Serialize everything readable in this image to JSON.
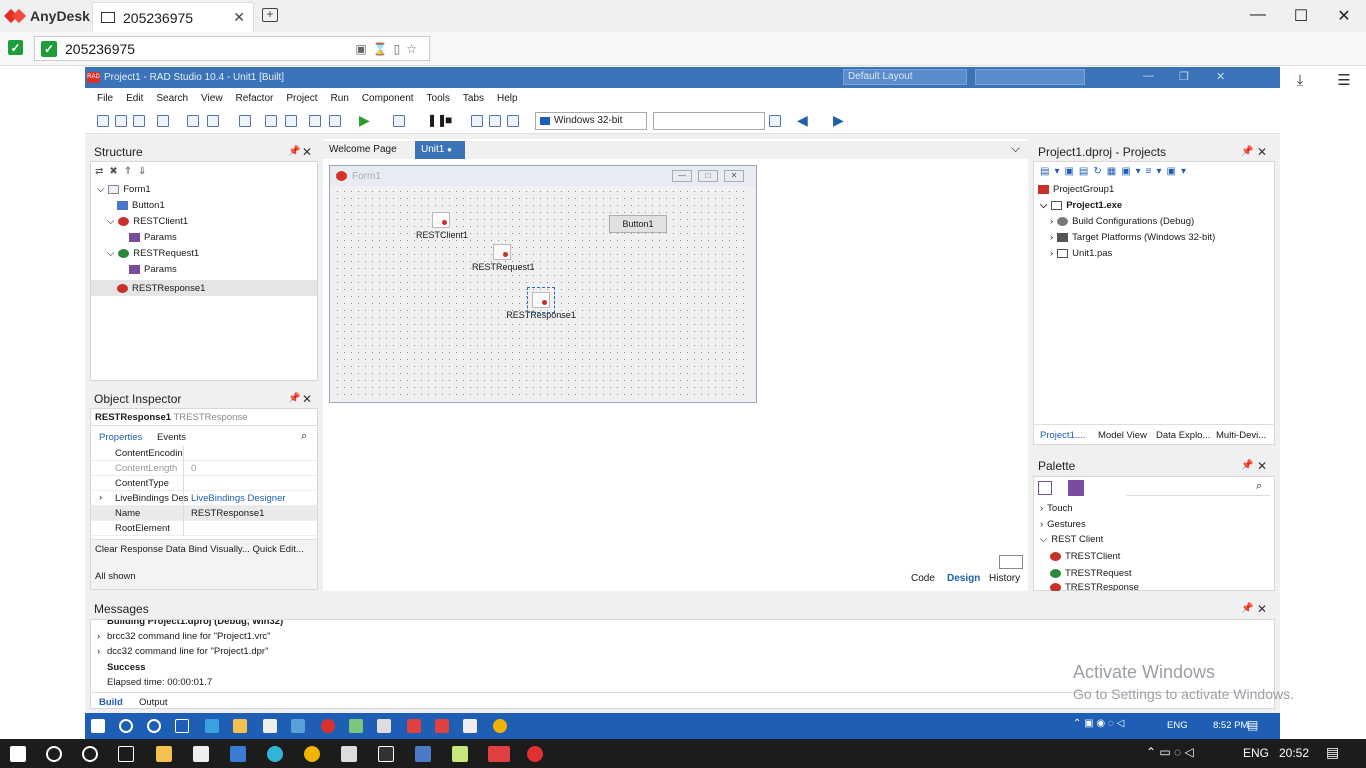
{
  "anydesk": {
    "app_name": "AnyDesk",
    "tab_label": "205236975",
    "address": "205236975",
    "monitor_number": "1",
    "tab_close": "✕",
    "new_tab": "+",
    "window_controls": {
      "minimize": "—",
      "maximize": "☐",
      "close": "✕"
    }
  },
  "ide": {
    "window_title": "Project1 - RAD Studio 10.4 - Unit1 [Built]",
    "layout_select": "Default Layout",
    "menu": [
      "File",
      "Edit",
      "Search",
      "View",
      "Refactor",
      "Project",
      "Run",
      "Component",
      "Tools",
      "Tabs",
      "Help"
    ],
    "platform": "Windows 32-bit"
  },
  "structure": {
    "title": "Structure",
    "items": [
      {
        "label": "Form1",
        "level": 0
      },
      {
        "label": "Button1",
        "level": 1
      },
      {
        "label": "RESTClient1",
        "level": 1
      },
      {
        "label": "Params",
        "level": 2
      },
      {
        "label": "RESTRequest1",
        "level": 1
      },
      {
        "label": "Params",
        "level": 2
      },
      {
        "label": "RESTResponse1",
        "level": 1
      }
    ]
  },
  "object_inspector": {
    "title": "Object Inspector",
    "selected_name": "RESTResponse1",
    "selected_type": "TRESTResponse",
    "tabs": [
      "Properties",
      "Events"
    ],
    "properties": [
      {
        "name": "ContentEncodin",
        "value": ""
      },
      {
        "name": "ContentLength",
        "value": "0"
      },
      {
        "name": "ContentType",
        "value": ""
      },
      {
        "name": "LiveBindings Des",
        "value": "LiveBindings Designer"
      },
      {
        "name": "Name",
        "value": "RESTResponse1"
      },
      {
        "name": "RootElement",
        "value": ""
      }
    ],
    "actions": [
      "Clear Response Data",
      "Bind Visually...",
      "Quick Edit..."
    ],
    "filter_status": "All shown"
  },
  "designer": {
    "tabs": [
      "Welcome Page",
      "Unit1"
    ],
    "form_title": "Form1",
    "components": [
      "RESTClient1",
      "RESTRequest1",
      "RESTResponse1"
    ],
    "button_label": "Button1",
    "bottom_tabs": [
      "Code",
      "Design",
      "History"
    ]
  },
  "projects": {
    "title": "Project1.dproj - Projects",
    "items": [
      {
        "label": "ProjectGroup1",
        "level": 0
      },
      {
        "label": "Project1.exe",
        "level": 1
      },
      {
        "label": "Build Configurations (Debug)",
        "level": 2
      },
      {
        "label": "Target Platforms (Windows 32-bit)",
        "level": 2
      },
      {
        "label": "Unit1.pas",
        "level": 2
      }
    ],
    "bottom_tabs": [
      "Project1....",
      "Model View",
      "Data Explo...",
      "Multi-Devi..."
    ]
  },
  "palette": {
    "title": "Palette",
    "items": [
      {
        "label": "Touch",
        "level": 0
      },
      {
        "label": "Gestures",
        "level": 0
      },
      {
        "label": "REST Client",
        "level": 0
      },
      {
        "label": "TRESTClient",
        "level": 1
      },
      {
        "label": "TRESTRequest",
        "level": 1
      },
      {
        "label": "TRESTResponse",
        "level": 1
      }
    ]
  },
  "messages": {
    "title": "Messages",
    "lines": [
      {
        "text": "Building Project1.dproj (Debug, Win32)",
        "bold": true
      },
      {
        "text": "brcc32 command line for \"Project1.vrc\"",
        "bold": false
      },
      {
        "text": "dcc32 command line for \"Project1.dpr\"",
        "bold": false
      },
      {
        "text": "Success",
        "bold": true
      },
      {
        "text": "Elapsed time: 00:00:01.7",
        "bold": false
      }
    ],
    "tabs": [
      "Build",
      "Output"
    ]
  },
  "remote_taskbar": {
    "lang": "ENG",
    "time": "8:52 PM"
  },
  "local_taskbar": {
    "lang": "ENG",
    "time": "20:52"
  },
  "watermark": {
    "line1": "Activate Windows",
    "line2": "Go to Settings to activate Windows."
  },
  "icons": {
    "pin": "pin-icon",
    "close": "close-icon",
    "search": "search-icon"
  }
}
